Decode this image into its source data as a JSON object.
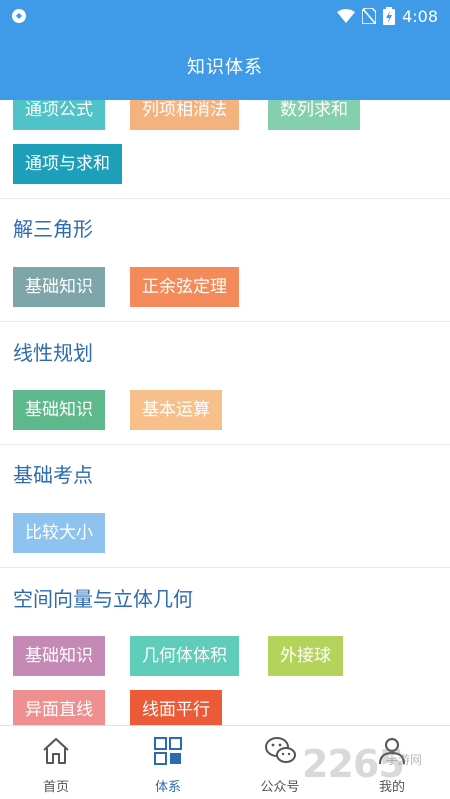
{
  "status_bar": {
    "time": "4:08"
  },
  "header": {
    "title": "知识体系"
  },
  "sections": [
    {
      "title": "",
      "tags": [
        "通项公式",
        "列项相消法",
        "数列求和",
        "通项与求和"
      ]
    },
    {
      "title": "解三角形",
      "tags": [
        "基础知识",
        "正余弦定理"
      ]
    },
    {
      "title": "线性规划",
      "tags": [
        "基础知识",
        "基本运算"
      ]
    },
    {
      "title": "基础考点",
      "tags": [
        "比较大小"
      ]
    },
    {
      "title": "空间向量与立体几何",
      "tags": [
        "基础知识",
        "几何体体积",
        "外接球",
        "异面直线",
        "线面平行"
      ]
    }
  ],
  "tag_colors": {
    "teal": "#4fc3c8",
    "peach": "#f4b27e",
    "mint": "#84cfac",
    "deep_teal": "#1e9fb9",
    "slate": "#7ea5a8",
    "orange": "#f48a5a",
    "green": "#5db98b",
    "light_peach": "#f7c08a",
    "sky": "#8ec3ef",
    "mauve": "#c489b4",
    "aqua": "#5fcdb9",
    "lime": "#b4d35b",
    "pink": "#ef8f8f",
    "red_orange": "#ec5a37"
  },
  "tabbar": {
    "tabs": [
      {
        "label": "首页",
        "icon": "home-icon"
      },
      {
        "label": "体系",
        "icon": "grid-icon"
      },
      {
        "label": "公众号",
        "icon": "wechat-icon"
      },
      {
        "label": "我的",
        "icon": "user-icon"
      }
    ]
  },
  "watermark": {
    "text": "2265",
    "sub": "手游网"
  },
  "colors": {
    "primary": "#3f9be8",
    "section_title": "#2d6bb1",
    "active_tab": "#2d6bb1"
  }
}
